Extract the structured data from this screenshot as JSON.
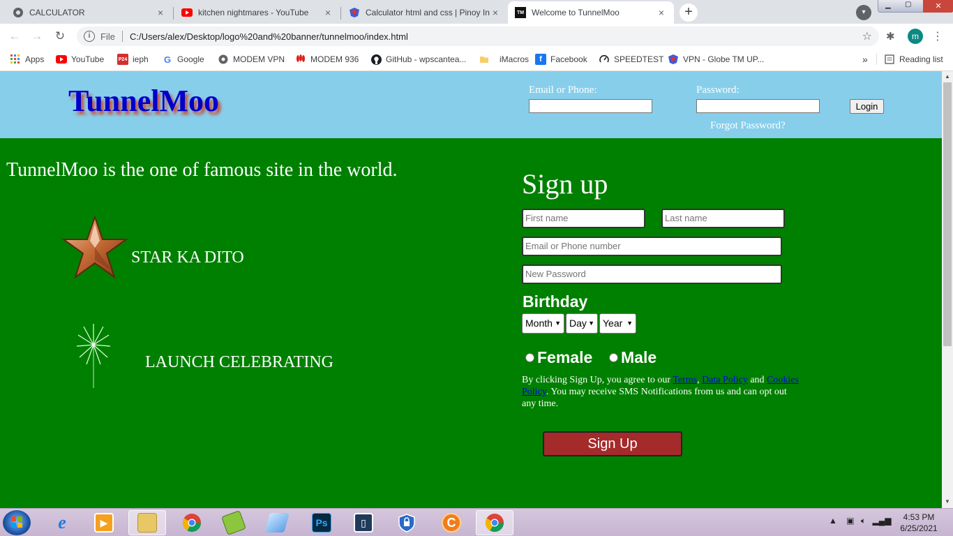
{
  "browser": {
    "tabs": [
      {
        "title": "CALCULATOR",
        "close": "×"
      },
      {
        "title": "kitchen nightmares - YouTube",
        "close": "×"
      },
      {
        "title": "Calculator html and css | Pinoy In",
        "close": "×"
      },
      {
        "title": "Welcome to TunnelMoo",
        "close": "×",
        "favicon_text": "TM"
      }
    ],
    "new_tab": "+",
    "address": {
      "scheme": "File",
      "url": "C:/Users/alex/Desktop/logo%20and%20banner/tunnelmoo/index.html"
    },
    "profile_initial": "m",
    "bookmarks": [
      {
        "label": "Apps",
        "icon": "apps-grid-icon"
      },
      {
        "label": "YouTube",
        "icon": "youtube-icon"
      },
      {
        "label": "ieph",
        "icon": "p24-icon"
      },
      {
        "label": "Google",
        "icon": "google-icon"
      },
      {
        "label": "MODEM VPN",
        "icon": "globe-icon"
      },
      {
        "label": "MODEM 936",
        "icon": "huawei-icon"
      },
      {
        "label": "GitHub - wpscantea...",
        "icon": "github-icon"
      },
      {
        "label": "iMacros",
        "icon": "folder-icon"
      },
      {
        "label": "Facebook",
        "icon": "facebook-icon"
      },
      {
        "label": "SPEEDTEST",
        "icon": "speedtest-icon"
      },
      {
        "label": "VPN - Globe TM UP...",
        "icon": "vpn-icon"
      }
    ],
    "bookmarks_more": "»",
    "reading_list": "Reading list"
  },
  "page": {
    "logo": "TunnelMoo",
    "login": {
      "email_label": "Email or Phone:",
      "password_label": "Password:",
      "login_button": "Login",
      "forgot": "Forgot Password?"
    },
    "tagline": "TunnelMoo is the one of famous site in the world.",
    "features": [
      {
        "label": "STAR KA DITO",
        "icon": "star-icon"
      },
      {
        "label": "LAUNCH CELEBRATING",
        "icon": "firework-icon"
      }
    ],
    "signup": {
      "title": "Sign up",
      "first_name": "First name",
      "last_name": "Last name",
      "email": "Email or Phone number",
      "password": "New Password",
      "birthday": "Birthday",
      "month": "Month",
      "day": "Day",
      "year": "Year",
      "female": "Female",
      "male": "Male",
      "terms_prefix": "By clicking Sign Up, you agree to our ",
      "terms_link": "Terms",
      "terms_sep": ", ",
      "data_link": "Data Policy",
      "terms_and": " and ",
      "cookies_link": "Cookies Policy",
      "terms_suffix": ". You may receive SMS Notifications from us and can opt out any time.",
      "button": "Sign Up"
    }
  },
  "taskbar": {
    "time": "4:53 PM",
    "date": "6/25/2021"
  },
  "colors": {
    "header_bg": "#87ceeb",
    "page_bg": "#008000",
    "logo": "#0000cd",
    "signup_button": "#a52a2a"
  }
}
